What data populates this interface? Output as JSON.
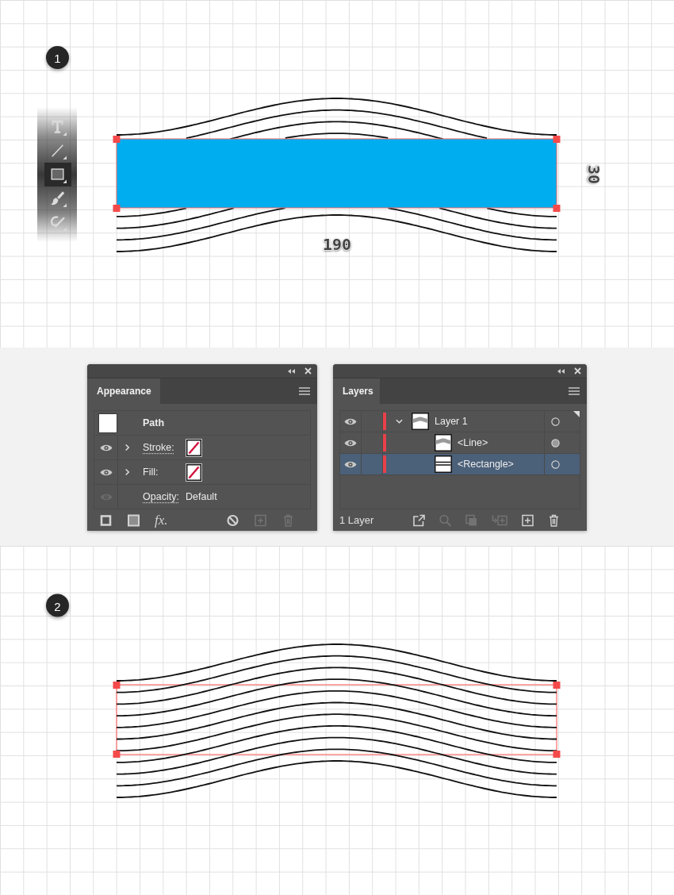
{
  "step_1": {
    "badge": "1",
    "toolbar": [
      {
        "kind": "type",
        "selected": false
      },
      {
        "kind": "line",
        "selected": false
      },
      {
        "kind": "rectangle",
        "selected": true
      },
      {
        "kind": "paintbrush",
        "selected": false
      },
      {
        "kind": "shaper",
        "selected": false
      }
    ],
    "width_label": "190",
    "height_label": "30"
  },
  "appearance_panel": {
    "title": "Appearance",
    "rows": [
      {
        "kind": "header",
        "label": "Path"
      },
      {
        "kind": "attribute",
        "label": "Stroke:",
        "visible": true,
        "expanded": false,
        "link": true,
        "no_color": true
      },
      {
        "kind": "attribute",
        "label": "Fill:",
        "visible": true,
        "expanded": false,
        "link": false,
        "no_color": true
      },
      {
        "kind": "opacity",
        "label": "Opacity:",
        "value": "Default",
        "visible": false,
        "link": true
      }
    ],
    "footer": [
      {
        "kind": "stroke",
        "disabled": false
      },
      {
        "kind": "fill",
        "disabled": false
      },
      {
        "kind": "effects",
        "label": "fx.",
        "disabled": false
      },
      {
        "kind": "clear",
        "disabled": false
      },
      {
        "kind": "duplicate",
        "disabled": true
      },
      {
        "kind": "delete",
        "disabled": true
      }
    ]
  },
  "layers_panel": {
    "title": "Layers",
    "layers": [
      {
        "kind": "layer",
        "name": "Layer 1",
        "visible": true,
        "expanded": true,
        "selected": false,
        "current": true,
        "target_filled": false,
        "children": [
          {
            "kind": "line",
            "name": "<Line>",
            "visible": true,
            "selected": false,
            "current": false,
            "target_filled": true
          },
          {
            "kind": "rectangle",
            "name": "<Rectangle>",
            "visible": true,
            "selected": true,
            "current": false,
            "target_filled": false
          }
        ]
      }
    ],
    "status": "1 Layer",
    "footer": [
      {
        "kind": "export",
        "disabled": false
      },
      {
        "kind": "locate",
        "disabled": true
      },
      {
        "kind": "clip",
        "disabled": true
      },
      {
        "kind": "new_sublayer",
        "disabled": true
      },
      {
        "kind": "new_layer",
        "disabled": false
      },
      {
        "kind": "delete",
        "disabled": false
      }
    ]
  },
  "step_2": {
    "badge": "2"
  }
}
